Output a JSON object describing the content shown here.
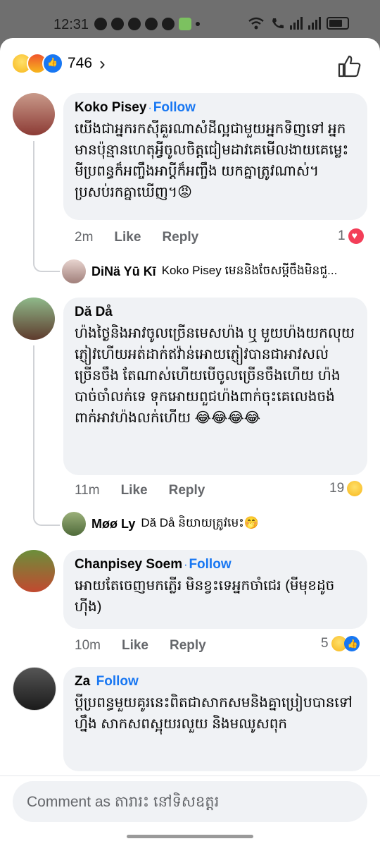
{
  "status": {
    "time": "12:31"
  },
  "reactions": {
    "count": "746"
  },
  "comments": [
    {
      "name": "Koko Pisey",
      "follow": "Follow",
      "text": "យើងជាអ្នករកស៊ីគួរណាសំដីល្អជាមួយអ្នកទិញទៅ អ្នកមានប៉ុន្មានហេតុអ្វីចូលចិត្តជៀមដាវគេមើលងាយគេម្លេះ មីប្រពន្ធក៏អញ្ចឹងអាប្ដីក៏អញ្ចឹង យកគ្នាត្រូវណាស់។ប្រសប់រកគ្នាឃើញ។😡",
      "time": "2m",
      "like": "Like",
      "reply": "Reply",
      "react_count": "1"
    },
    {
      "name": "Dă Då",
      "follow": "",
      "text": "ហ៉ងថ្ងៃនិងអាវចូលច្រើនមេសហ៉ង ឬ មួយហ៉ងយកលុយភ្ញៀវហើយអត់ដាក់ឥវ៉ាន់អោយភ្ញៀវបានជាអាវសល់ច្រើនចឹង តែណាស់ហើយបើចូលច្រើនចឹងហើយ ហ៉ងបាច់ចាំលក់ទេ ទុកអោយពួជហ៉ងពាក់ចុះគេលេងចង់ពាក់អាវហ៉ងលក់ហើយ 😂😂😂😂",
      "time": "11m",
      "like": "Like",
      "reply": "Reply",
      "react_count": "19"
    },
    {
      "name": "Chanpisey Soem",
      "follow": "Follow",
      "text": "អោយតែចេញមកភ្លើរ មិនខ្វះទេអ្នកចាំជេរ (មីមុខដូចហ៊ីង)",
      "time": "10m",
      "like": "Like",
      "reply": "Reply",
      "react_count": "5"
    },
    {
      "name": "Za",
      "follow": "Follow",
      "text": "ប្ដីប្រពន្ធមួយគូរនេះពិតជាសាកសមនិងគ្នាប្រៀបបានទៅហ្នឹង សាកសពស្អុយរលួយ និងមឈូសពុក"
    }
  ],
  "replies": [
    {
      "name": "DiNä Yū Kī",
      "text": "Koko Pisey មេននិងចែសម្ដីចឹងមិនជួ..."
    },
    {
      "name": "Møø Ly",
      "text": "Dă Då និយាយត្រូវមេះ🤭"
    }
  ],
  "composer": {
    "placeholder": "Comment as តារារះ នៅទិសឧត្តរ"
  }
}
